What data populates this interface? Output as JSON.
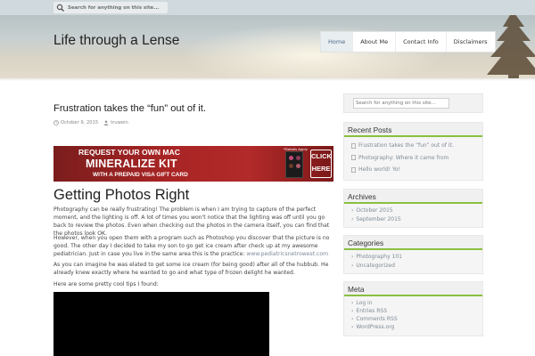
{
  "topbar": {
    "search_placeholder": "Search for anything on this site..."
  },
  "header": {
    "site_title": "Life through a Lense",
    "nav": [
      {
        "label": "Home",
        "active": true
      },
      {
        "label": "About Me",
        "active": false
      },
      {
        "label": "Contact Info",
        "active": false
      },
      {
        "label": "Disclaimers",
        "active": false
      }
    ]
  },
  "post": {
    "title": "Frustration takes the “fun” out of it.",
    "date": "October 9, 2015",
    "author": "truwein",
    "ad": {
      "line1": "REQUEST YOUR OWN MAC",
      "line2": "MINERALIZE KIT",
      "line3": "WITH A PREPAID VISA GIFT CARD",
      "details": "*Details Apply",
      "cta_line1": "CLICK",
      "cta_line2": "HERE"
    },
    "section_heading": "Getting Photos Right",
    "paragraphs": {
      "p1": "Photography can be really frustrating! The problem is when I am trying to capture of the perfect moment, and the lighting is off. A lot of times you won't notice that the lighting was off until you go back to review the photos. Even when checking out the photos in the camera itself, you can find that the photos look OK.",
      "p2_text": "However, when you open them with a program such as Photoshop you discover that the picture is no good. The other day I decided to take my son to go get ice cream after check up at my awesome pediatrician.  Just in case you live in the same area this is the practice: ",
      "p2_link": "www.pediatricsnetrowest.com",
      "p3": "As you can imagine he was elated to get some ice cream (for being good) after all of the hubbub. He already knew exactly where he wanted to go and what type of frozen delight he wanted.",
      "p4": "Here are some pretty cool tips I found:"
    }
  },
  "sidebar": {
    "search_placeholder": "Search for anything on this site...",
    "recent_posts": {
      "title": "Recent Posts",
      "items": [
        "Frustration takes the “fun” out of it.",
        "Photography: Where it came from",
        "Hello world! Yo!"
      ]
    },
    "archives": {
      "title": "Archives",
      "items": [
        "October 2015",
        "September 2015"
      ]
    },
    "categories": {
      "title": "Categories",
      "items": [
        "Photography 101",
        "Uncategorized"
      ]
    },
    "meta": {
      "title": "Meta",
      "items": [
        "Log in",
        "Entries RSS",
        "Comments RSS",
        "WordPress.org"
      ]
    }
  },
  "colors": {
    "accent_green": "#8ac040",
    "link_gray_blue": "#7f8b97",
    "ad_red": "#a82424"
  }
}
